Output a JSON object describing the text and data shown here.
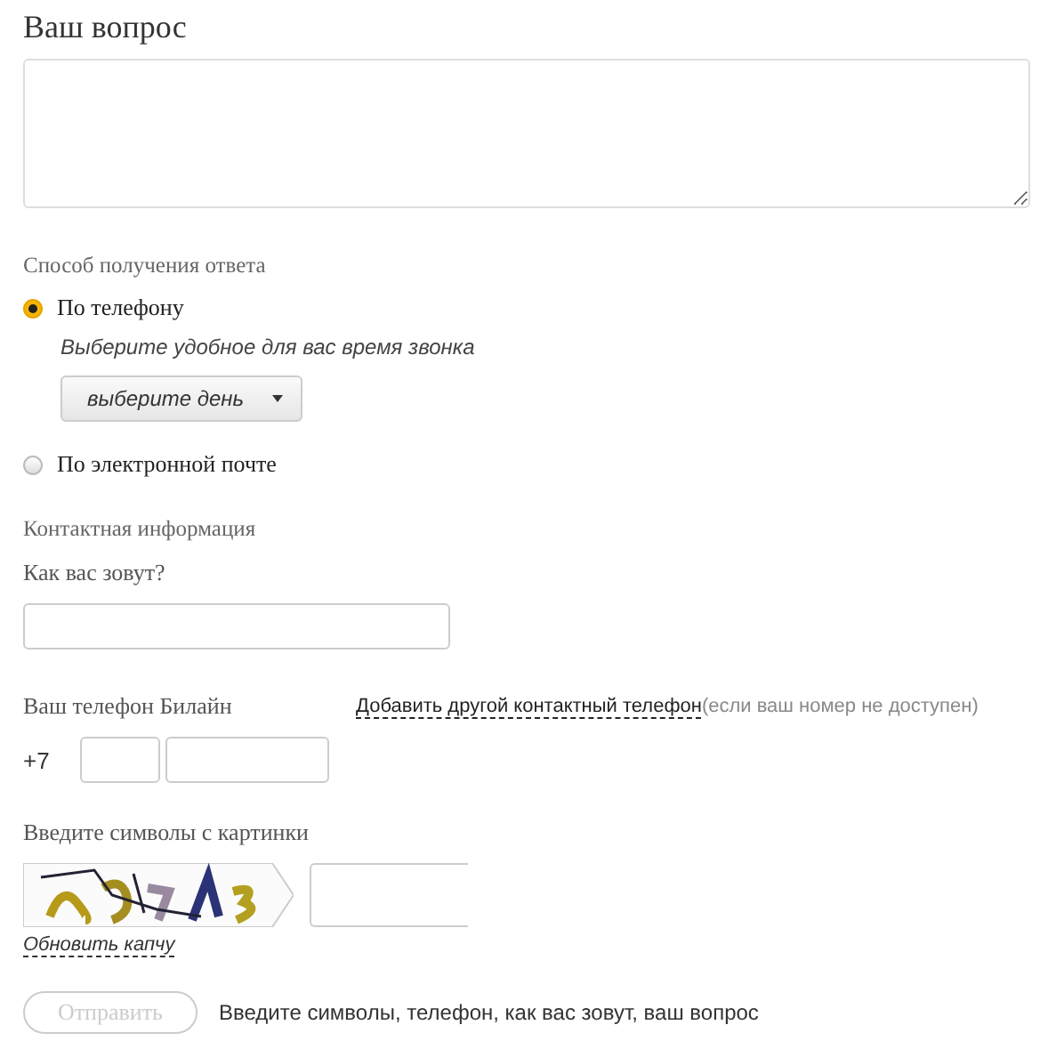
{
  "title": "Ваш вопрос",
  "answer_method": {
    "label": "Способ получения ответа",
    "options": [
      {
        "label": "По телефону",
        "selected": true
      },
      {
        "label": "По электронной почте",
        "selected": false
      }
    ],
    "call_time": {
      "hint": "Выберите удобное для вас время звонка",
      "day_select": "выберите день"
    }
  },
  "contact": {
    "label": "Контактная информация",
    "name_label": "Как вас зовут?",
    "phone_label": "Ваш телефон Билайн",
    "add_phone_link": "Добавить другой контактный телефон",
    "add_phone_note": "(если ваш номер не доступен)",
    "country_code": "+7"
  },
  "captcha": {
    "label": "Введите символы с картинки",
    "refresh_link": "Обновить капчу"
  },
  "submit": {
    "label": "Отправить",
    "disabled": true
  },
  "submit_hint": "Введите символы, телефон, как вас зовут, ваш вопрос"
}
